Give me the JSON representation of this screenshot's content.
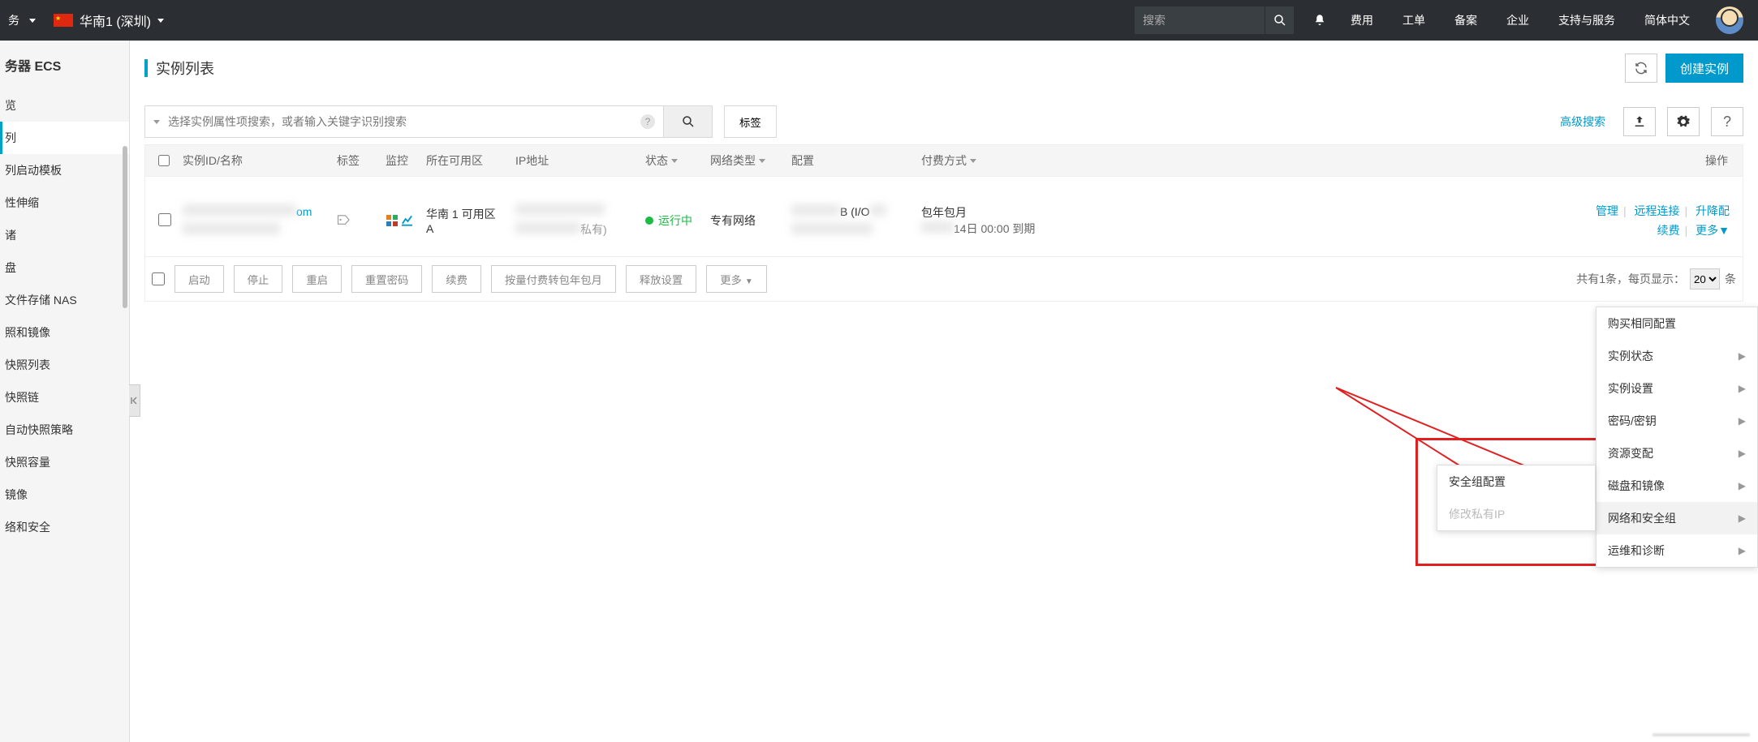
{
  "topbar": {
    "service_suffix": "务",
    "region": "华南1 (深圳)",
    "search_placeholder": "搜索",
    "links": [
      "费用",
      "工单",
      "备案",
      "企业",
      "支持与服务",
      "简体中文"
    ]
  },
  "sidebar": {
    "header": "务器 ECS",
    "items": [
      "览",
      "列",
      "列启动模板",
      "性伸缩",
      "诸",
      "盘",
      "文件存储 NAS",
      "照和镜像",
      "快照列表",
      "快照链",
      "自动快照策略",
      "快照容量",
      "镜像",
      "络和安全"
    ],
    "active_index": 1
  },
  "page": {
    "title": "实例列表",
    "create_btn": "创建实例",
    "search_placeholder": "选择实例属性项搜索，或者输入关键字识别搜索",
    "tag_btn": "标签",
    "advanced_search": "高级搜索"
  },
  "table": {
    "headers": {
      "id": "实例ID/名称",
      "tag": "标签",
      "monitor": "监控",
      "zone": "所在可用区",
      "ip": "IP地址",
      "status": "状态",
      "nettype": "网络类型",
      "config": "配置",
      "paytype": "付费方式",
      "ops": "操作"
    },
    "row": {
      "id_suffix": "om",
      "zone": "华南 1 可用区 A",
      "ip_suffix": "私有)",
      "status": "运行中",
      "nettype": "专有网络",
      "config_part": "B (I/O",
      "paytype": "包年包月",
      "expire": "14日 00:00 到期",
      "actions": {
        "manage": "管理",
        "remote": "远程连接",
        "scale": "升降配",
        "renew": "续费",
        "more": "更多"
      }
    },
    "pager": {
      "total_text": "共有1条，每页显示：",
      "per_page": "20",
      "unit": "条"
    },
    "batch": {
      "start": "启动",
      "stop": "停止",
      "restart": "重启",
      "resetpw": "重置密码",
      "renew": "续费",
      "convert": "按量付费转包年包月",
      "release": "释放设置",
      "more": "更多"
    }
  },
  "more_menu": {
    "items": [
      "购买相同配置",
      "实例状态",
      "实例设置",
      "密码/密钥",
      "资源变配",
      "磁盘和镜像",
      "网络和安全组",
      "运维和诊断"
    ],
    "hover_index": 6,
    "submenu": {
      "items": [
        "安全组配置",
        "修改私有IP"
      ],
      "disabled_index": 1
    }
  }
}
